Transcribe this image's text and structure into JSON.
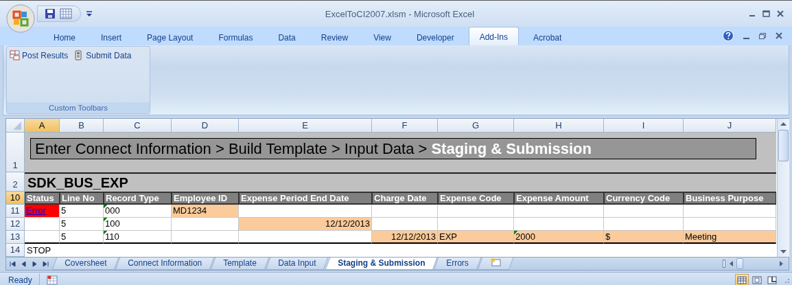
{
  "window": {
    "title": "ExcelToCI2007.xlsm - Microsoft Excel"
  },
  "ribbon_tabs": [
    {
      "label": "Home",
      "selected": false
    },
    {
      "label": "Insert",
      "selected": false
    },
    {
      "label": "Page Layout",
      "selected": false
    },
    {
      "label": "Formulas",
      "selected": false
    },
    {
      "label": "Data",
      "selected": false
    },
    {
      "label": "Review",
      "selected": false
    },
    {
      "label": "View",
      "selected": false
    },
    {
      "label": "Developer",
      "selected": false
    },
    {
      "label": "Add-Ins",
      "selected": true
    },
    {
      "label": "Acrobat",
      "selected": false
    }
  ],
  "ribbon_group": {
    "label": "Custom Toolbars",
    "buttons": [
      {
        "label": "Post Results",
        "kind": "grid"
      },
      {
        "label": "Submit Data",
        "kind": "device"
      }
    ]
  },
  "sheet": {
    "columns": [
      {
        "label": "A",
        "selected": true
      },
      {
        "label": "B",
        "selected": false
      },
      {
        "label": "C",
        "selected": false
      },
      {
        "label": "D",
        "selected": false
      },
      {
        "label": "E",
        "selected": false
      },
      {
        "label": "F",
        "selected": false
      },
      {
        "label": "G",
        "selected": false
      },
      {
        "label": "H",
        "selected": false
      },
      {
        "label": "I",
        "selected": false
      },
      {
        "label": "J",
        "selected": false
      }
    ],
    "rows": [
      {
        "number": "1",
        "selected": false,
        "kind": "banner",
        "text": "Enter Connect Information > Build Template > Input Data > **Staging & Submission**"
      },
      {
        "number": "2",
        "selected": false,
        "kind": "title",
        "text": "SDK_BUS_EXP"
      },
      {
        "number": "10",
        "selected": true,
        "kind": "header",
        "cells": [
          {
            "text": "Status"
          },
          {
            "text": "Line No"
          },
          {
            "text": "Record Type"
          },
          {
            "text": "Employee ID"
          },
          {
            "text": "Expense Period End Date"
          },
          {
            "text": "Charge Date"
          },
          {
            "text": "Expense Code"
          },
          {
            "text": "Expense Amount"
          },
          {
            "text": "Currency Code"
          },
          {
            "text": "Business Purpose"
          }
        ]
      },
      {
        "number": "11",
        "selected": false,
        "kind": "data",
        "cells": [
          {
            "text": "Error",
            "kind": "link",
            "color": "#ff0000",
            "flag": false
          },
          {
            "text": "5",
            "flag": false
          },
          {
            "text": "000",
            "flag": true
          },
          {
            "text": "MD1234",
            "color": "#fbcb9b",
            "flag": false
          },
          {
            "flag": false
          },
          {
            "flag": false
          },
          {
            "flag": false
          },
          {
            "flag": false
          },
          {
            "flag": false
          },
          {
            "flag": false
          }
        ]
      },
      {
        "number": "12",
        "selected": false,
        "kind": "data",
        "cells": [
          {
            "flag": false
          },
          {
            "text": "5",
            "flag": false
          },
          {
            "text": "100",
            "flag": true
          },
          {
            "flag": false
          },
          {
            "text": "12/12/2013",
            "kind": "date",
            "color": "#fbcb9b",
            "flag": false
          },
          {
            "flag": false
          },
          {
            "flag": false
          },
          {
            "flag": false
          },
          {
            "flag": false
          },
          {
            "flag": false
          }
        ]
      },
      {
        "number": "13",
        "selected": false,
        "kind": "data",
        "cells": [
          {
            "flag": false
          },
          {
            "text": "5",
            "flag": false
          },
          {
            "text": "110",
            "flag": true
          },
          {
            "flag": false
          },
          {
            "flag": false
          },
          {
            "text": "12/12/2013",
            "kind": "date",
            "color": "#fbcb9b",
            "flag": false
          },
          {
            "text": "EXP",
            "color": "#fbcb9b",
            "flag": false
          },
          {
            "text": "2000",
            "color": "#fbcb9b",
            "flag": true
          },
          {
            "text": "$",
            "color": "#fbcb9b",
            "flag": false
          },
          {
            "text": "Meeting",
            "color": "#fbcb9b",
            "flag": false
          }
        ]
      },
      {
        "number": "14",
        "selected": false,
        "kind": "plain",
        "text": "STOP"
      }
    ]
  },
  "sheet_tabs": [
    {
      "label": "Coversheet",
      "selected": false
    },
    {
      "label": "Connect Information",
      "selected": false
    },
    {
      "label": "Template",
      "selected": false
    },
    {
      "label": "Data Input",
      "selected": false
    },
    {
      "label": "Staging & Submission",
      "selected": true
    },
    {
      "label": "Errors",
      "selected": false
    }
  ],
  "status_bar": {
    "text": "Ready",
    "views": [
      {
        "selected": true
      },
      {
        "selected": false
      },
      {
        "selected": false
      }
    ]
  }
}
